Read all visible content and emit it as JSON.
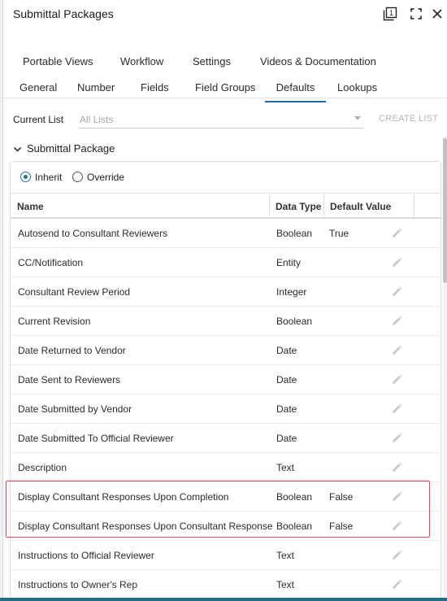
{
  "header": {
    "title": "Submittal Packages",
    "icons": [
      "window-tag-icon",
      "expand-icon",
      "close-icon"
    ],
    "badge_number": "1"
  },
  "tabs": {
    "row1": [
      {
        "label": "Portable Views"
      },
      {
        "label": "Workflow"
      },
      {
        "label": "Settings"
      },
      {
        "label": "Videos & Documentation"
      }
    ],
    "row2": [
      {
        "label": "General"
      },
      {
        "label": "Number"
      },
      {
        "label": "Fields"
      },
      {
        "label": "Field Groups"
      },
      {
        "label": "Defaults",
        "active": true
      },
      {
        "label": "Lookups"
      }
    ]
  },
  "current_list": {
    "label": "Current List",
    "placeholder": "All Lists",
    "create_button": "CREATE LIST"
  },
  "section": {
    "title": "Submittal Package",
    "inherit_label": "Inherit",
    "override_label": "Override",
    "selected": "Inherit"
  },
  "table": {
    "headers": {
      "name": "Name",
      "data_type": "Data Type",
      "default_value": "Default Value"
    },
    "rows": [
      {
        "name": "Autosend to Consultant Reviewers",
        "type": "Boolean",
        "default": "True"
      },
      {
        "name": "CC/Notification",
        "type": "Entity",
        "default": ""
      },
      {
        "name": "Consultant Review Period",
        "type": "Integer",
        "default": ""
      },
      {
        "name": "Current Revision",
        "type": "Boolean",
        "default": ""
      },
      {
        "name": "Date Returned to Vendor",
        "type": "Date",
        "default": ""
      },
      {
        "name": "Date Sent to Reviewers",
        "type": "Date",
        "default": ""
      },
      {
        "name": "Date Submitted by Vendor",
        "type": "Date",
        "default": ""
      },
      {
        "name": "Date Submitted To Official Reviewer",
        "type": "Date",
        "default": ""
      },
      {
        "name": "Description",
        "type": "Text",
        "default": ""
      },
      {
        "name": "Display Consultant Responses Upon Completion",
        "type": "Boolean",
        "default": "False"
      },
      {
        "name": "Display Consultant Responses Upon Consultant Response",
        "type": "Boolean",
        "default": "False"
      },
      {
        "name": "Instructions to Official Reviewer",
        "type": "Text",
        "default": ""
      },
      {
        "name": "Instructions to Owner's Rep",
        "type": "Text",
        "default": ""
      }
    ]
  },
  "colors": {
    "accent": "#1e6e9f",
    "highlight": "#e0464f",
    "bottom_bar": "#1c6e8a"
  }
}
